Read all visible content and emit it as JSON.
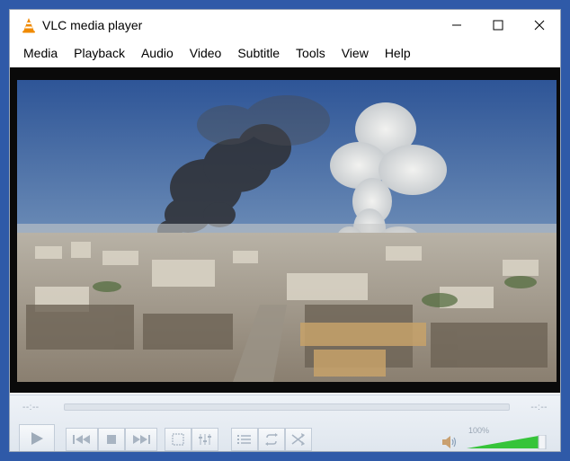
{
  "window": {
    "title": "VLC media player",
    "controls": [
      "minimize",
      "maximize",
      "close"
    ]
  },
  "menu": [
    "Media",
    "Playback",
    "Audio",
    "Video",
    "Subtitle",
    "Tools",
    "View",
    "Help"
  ],
  "video": {
    "description_icon": "video-frame"
  },
  "playback": {
    "time_elapsed": "--:--",
    "time_total": "--:--",
    "progress": 0
  },
  "volume": {
    "label": "100%",
    "level": 1.0
  },
  "colors": {
    "desktop": "#2f5aa8",
    "vlc_orange": "#f08a00",
    "volume_green": "#36c43a",
    "control_bg": "#e6ecf2"
  }
}
